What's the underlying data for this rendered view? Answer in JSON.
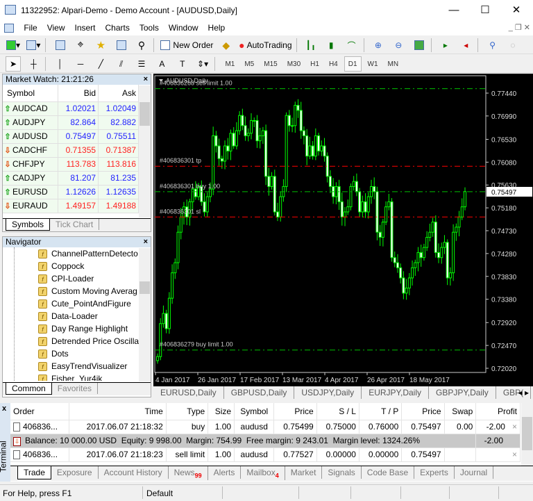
{
  "window": {
    "title": "11322952: Alpari-Demo - Demo Account - [AUDUSD,Daily]",
    "minimize": "—",
    "maximize": "☐",
    "close": "✕"
  },
  "menu": [
    "File",
    "View",
    "Insert",
    "Charts",
    "Tools",
    "Window",
    "Help"
  ],
  "toolbar": {
    "new_order": "New Order",
    "autotrading": "AutoTrading"
  },
  "timeframes": [
    "M1",
    "M5",
    "M15",
    "M30",
    "H1",
    "H4",
    "D1",
    "W1",
    "MN"
  ],
  "active_timeframe": "D1",
  "market_watch": {
    "title": "Market Watch: 21:21:26",
    "headers": [
      "Symbol",
      "Bid",
      "Ask"
    ],
    "rows": [
      {
        "symbol": "AUDCAD",
        "bid": "1.02021",
        "ask": "1.02049",
        "dir": "up"
      },
      {
        "symbol": "AUDJPY",
        "bid": "82.864",
        "ask": "82.882",
        "dir": "up"
      },
      {
        "symbol": "AUDUSD",
        "bid": "0.75497",
        "ask": "0.75511",
        "dir": "up"
      },
      {
        "symbol": "CADCHF",
        "bid": "0.71355",
        "ask": "0.71387",
        "dir": "down"
      },
      {
        "symbol": "CHFJPY",
        "bid": "113.783",
        "ask": "113.816",
        "dir": "down"
      },
      {
        "symbol": "CADJPY",
        "bid": "81.207",
        "ask": "81.235",
        "dir": "up"
      },
      {
        "symbol": "EURUSD",
        "bid": "1.12626",
        "ask": "1.12635",
        "dir": "up"
      },
      {
        "symbol": "EURAUD",
        "bid": "1.49157",
        "ask": "1.49188",
        "dir": "down"
      }
    ],
    "tabs": [
      "Symbols",
      "Tick Chart"
    ]
  },
  "navigator": {
    "title": "Navigator",
    "items": [
      "ChannelPatternDetecto",
      "Coppock",
      "CPI-Loader",
      "Custom Moving Averag",
      "Cute_PointAndFigure",
      "Data-Loader",
      "Day Range Highlight",
      "Detrended Price Oscillat",
      "Dots",
      "EasyTrendVisualizer",
      "Fisher_Yur4ik"
    ],
    "tabs": [
      "Common",
      "Favorites"
    ]
  },
  "chart": {
    "title": "AUDUSD,Daily",
    "current_price": "0.75497",
    "colors": {
      "bull": "#00ff00",
      "bear": "#ffffff",
      "sl_tp": "#ff0000",
      "order": "#00c000"
    },
    "price_labels": [
      "0.77440",
      "0.76990",
      "0.76530",
      "0.76080",
      "0.75630",
      "0.75180",
      "0.74730",
      "0.74280",
      "0.73830",
      "0.73380",
      "0.72920",
      "0.72470",
      "0.72020"
    ],
    "date_labels": [
      "4 Jan 2017",
      "26 Jan 2017",
      "17 Feb 2017",
      "13 Mar 2017",
      "4 Apr 2017",
      "26 Apr 2017",
      "18 May 2017"
    ],
    "order_lines": [
      {
        "label": "#406836268 sell limit 1.00",
        "price": 0.77527,
        "kind": "order"
      },
      {
        "label": "#406836301 tp",
        "price": 0.76,
        "kind": "sl_tp"
      },
      {
        "label": "#406836301 buy 1.00",
        "price": 0.75499,
        "kind": "order"
      },
      {
        "label": "#406836301 sl",
        "price": 0.75,
        "kind": "sl_tp"
      },
      {
        "label": "#406836279 buy limit 1.00",
        "price": 0.7238,
        "kind": "order"
      }
    ],
    "closes": [
      0.7225,
      0.729,
      0.731,
      0.728,
      0.734,
      0.739,
      0.741,
      0.747,
      0.75,
      0.752,
      0.75,
      0.753,
      0.7555,
      0.754,
      0.756,
      0.753,
      0.751,
      0.754,
      0.7555,
      0.766,
      0.764,
      0.7615,
      0.761,
      0.764,
      0.763,
      0.7665,
      0.764,
      0.767,
      0.77,
      0.768,
      0.766,
      0.7665,
      0.769,
      0.769,
      0.765,
      0.766,
      0.767,
      0.758,
      0.756,
      0.758,
      0.751,
      0.75,
      0.754,
      0.756,
      0.77,
      0.768,
      0.768,
      0.772,
      0.771,
      0.767,
      0.766,
      0.762,
      0.764,
      0.762,
      0.766,
      0.763,
      0.764,
      0.762,
      0.758,
      0.756,
      0.754,
      0.756,
      0.753,
      0.75,
      0.751,
      0.752,
      0.756,
      0.757,
      0.755,
      0.751,
      0.753,
      0.751,
      0.754,
      0.756,
      0.755,
      0.747,
      0.746,
      0.749,
      0.752,
      0.753,
      0.742,
      0.741,
      0.74,
      0.738,
      0.735,
      0.736,
      0.738,
      0.74,
      0.741,
      0.743,
      0.742,
      0.744,
      0.746,
      0.747,
      0.749,
      0.743,
      0.742,
      0.744,
      0.745,
      0.738,
      0.739,
      0.747,
      0.748,
      0.75,
      0.752,
      0.755
    ]
  },
  "chart_tabs": [
    "EURUSD,Daily",
    "GBPUSD,Daily",
    "USDJPY,Daily",
    "EURJPY,Daily",
    "GBPJPY,Daily",
    "GBP("
  ],
  "terminal": {
    "label": "Terminal",
    "headers": [
      "Order",
      "Time",
      "Type",
      "Size",
      "Symbol",
      "Price",
      "S / L",
      "T / P",
      "Price",
      "Swap",
      "Profit"
    ],
    "rows": [
      [
        "406836...",
        "2017.06.07 21:18:32",
        "buy",
        "1.00",
        "audusd",
        "0.75499",
        "0.75000",
        "0.76000",
        "0.75497",
        "0.00",
        "-2.00"
      ],
      [
        "406836...",
        "2017.06.07 21:18:23",
        "sell limit",
        "1.00",
        "audusd",
        "0.77527",
        "0.00000",
        "0.00000",
        "0.75497",
        "",
        ""
      ]
    ],
    "balance": "Balance: 10 000.00 USD  Equity: 9 998.00  Margin: 754.99  Free margin: 9 243.01  Margin level: 1324.26%",
    "balance_profit": "-2.00",
    "tabs": [
      {
        "label": "Trade"
      },
      {
        "label": "Exposure"
      },
      {
        "label": "Account History"
      },
      {
        "label": "News",
        "badge": "99"
      },
      {
        "label": "Alerts"
      },
      {
        "label": "Mailbox",
        "badge": "4"
      },
      {
        "label": "Market"
      },
      {
        "label": "Signals"
      },
      {
        "label": "Code Base"
      },
      {
        "label": "Experts"
      },
      {
        "label": "Journal"
      }
    ]
  },
  "status": {
    "help": "For Help, press F1",
    "profile": "Default"
  }
}
